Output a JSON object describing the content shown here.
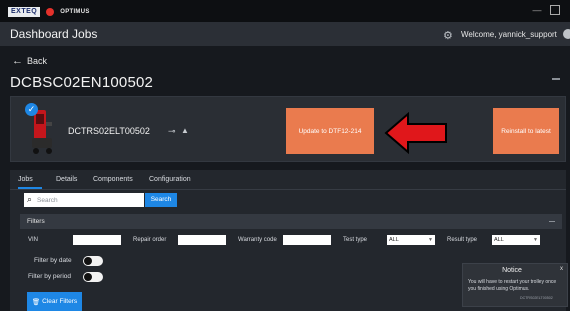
{
  "titlebar": {
    "logo": "EXTEQ",
    "app": "OPTIMUS",
    "minimize": "—"
  },
  "header": {
    "title": "Dashboard  Jobs",
    "welcome": "Welcome, yannick_support"
  },
  "nav": {
    "back": "Back"
  },
  "device": {
    "title": "DCBSC02EN100502",
    "name": "DCTRS02ELT00502",
    "update_label": "Update to DTF12-214",
    "reinstall_label": "Reinstall to latest"
  },
  "tabs": [
    "Jobs",
    "Details",
    "Components",
    "Configuration"
  ],
  "search": {
    "placeholder": "Search",
    "button": "Search"
  },
  "filters": {
    "title": "Filters",
    "vin": "VIN",
    "repair_order": "Repair order",
    "warranty_code": "Warranty code",
    "test_type": "Test type",
    "test_type_value": "ALL",
    "result_type": "Result type",
    "result_type_value": "ALL",
    "filter_by_date": "Filter by date",
    "filter_by_period": "Filter by period",
    "clear": "Clear Filters"
  },
  "notice": {
    "title": "Notice",
    "close": "x",
    "text": "You will have to restart your trolley once you finished using Optimus.",
    "id": "DCTRS02ELT00502"
  },
  "colors": {
    "accent": "#1e87e5",
    "action": "#ea7b4e",
    "arrow": "#e0171b"
  }
}
